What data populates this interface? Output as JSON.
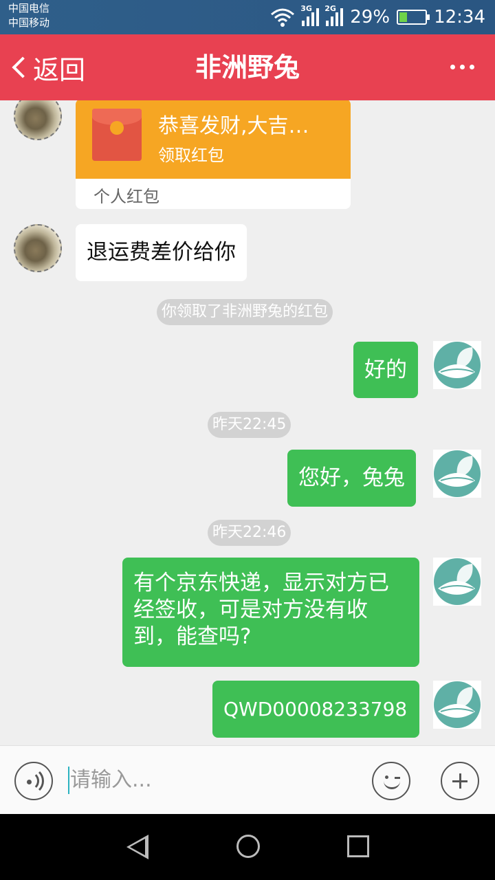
{
  "status_bar": {
    "carrier1": "中国电信",
    "carrier2": "中国移动",
    "net1": "3G",
    "net2": "2G",
    "battery": "29%",
    "time": "12:34"
  },
  "header": {
    "back_label": "返回",
    "title": "非洲野兔",
    "accent_color": "#e84151"
  },
  "messages": {
    "red_packet": {
      "title": "恭喜发财,大吉…",
      "action": "领取红包",
      "footer": "个人红包"
    },
    "m1": "退运费差价给你",
    "notice": "你领取了非洲野兔的红包",
    "m2": "好的",
    "time1": "昨天22:45",
    "m3": "您好，兔兔",
    "time2": "昨天22:46",
    "m4_line1": "有个京东快递，显示对方已",
    "m4_line2": "经签收，可是对方没有收",
    "m4_line3": "到，能查吗?",
    "m5": "QWD00008233798",
    "bubble_color": "#3fbf55"
  },
  "input_bar": {
    "placeholder": "请输入..."
  },
  "icons": {
    "back": "chevron-left-icon",
    "more": "more-dots-icon",
    "voice": "voice-icon",
    "emoji": "emoji-icon",
    "plus": "plus-icon"
  }
}
